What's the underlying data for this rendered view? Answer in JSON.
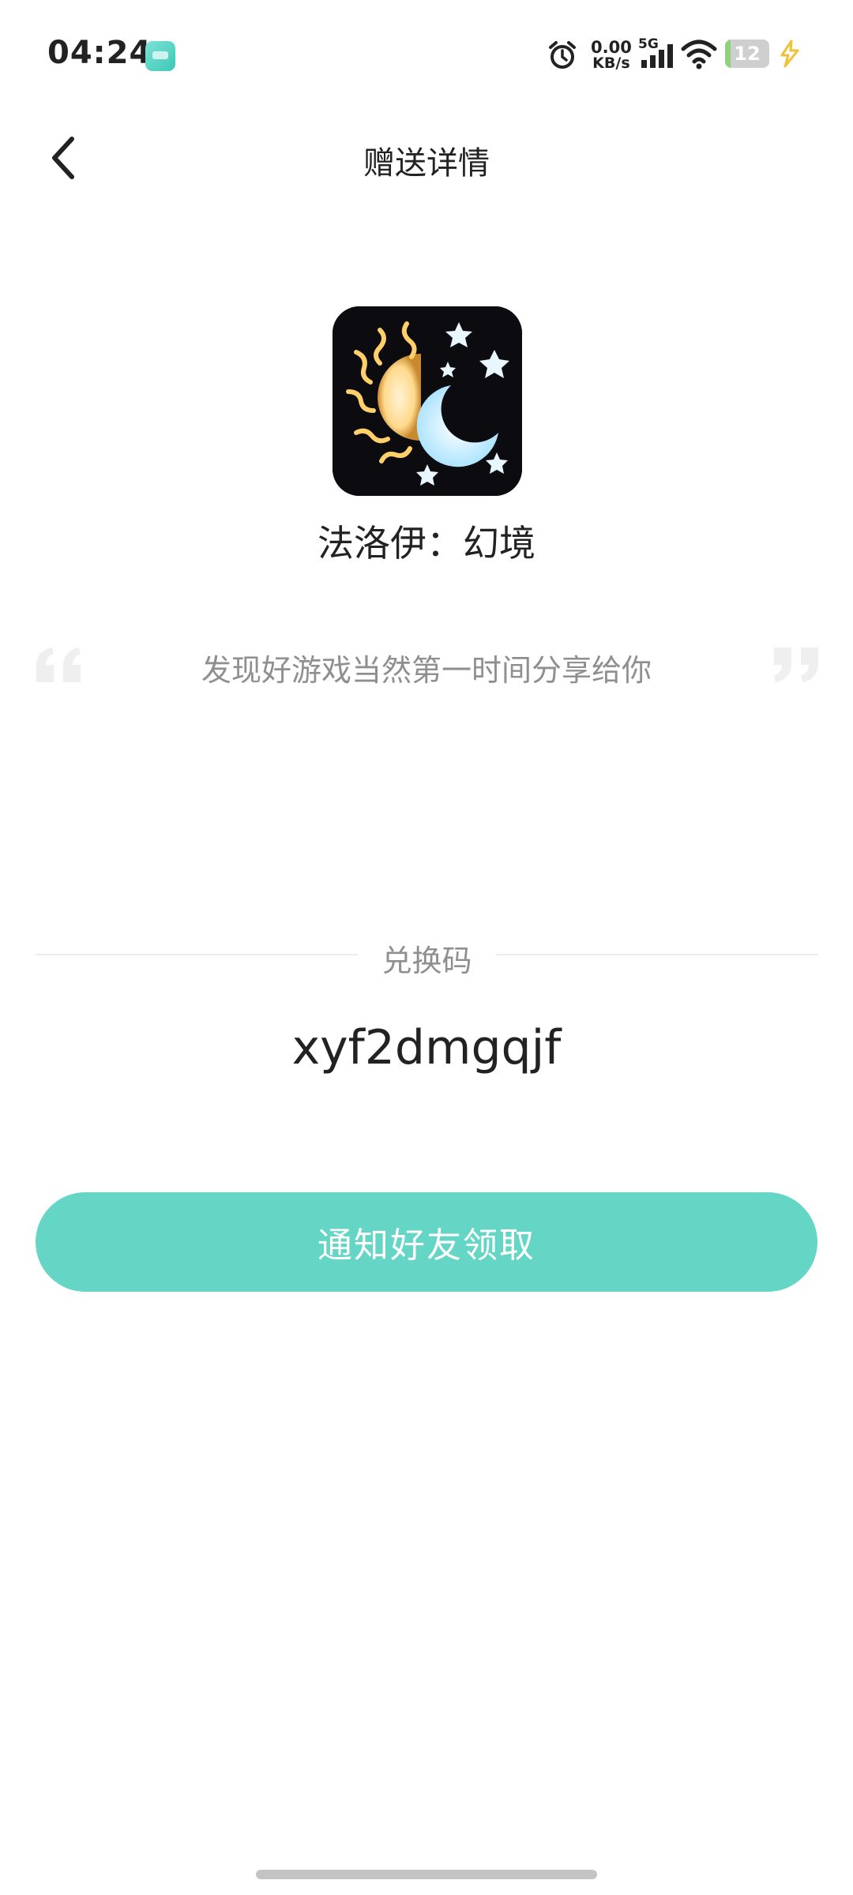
{
  "status_bar": {
    "time": "04:24",
    "net_speed_value": "0.00",
    "net_speed_unit": "KB/s",
    "network_type": "5G",
    "battery_level": "12",
    "battery_fraction": 0.12
  },
  "header": {
    "title": "赠送详情"
  },
  "game": {
    "name": "法洛伊：幻境"
  },
  "quote": {
    "text": "发现好游戏当然第一时间分享给你"
  },
  "redeem": {
    "label": "兑换码",
    "code": "xyf2dmgqjf"
  },
  "actions": {
    "notify_label": "通知好友领取"
  },
  "colors": {
    "accent": "#65d6c5",
    "muted_text": "#8f8f8f",
    "primary_text": "#222222"
  }
}
